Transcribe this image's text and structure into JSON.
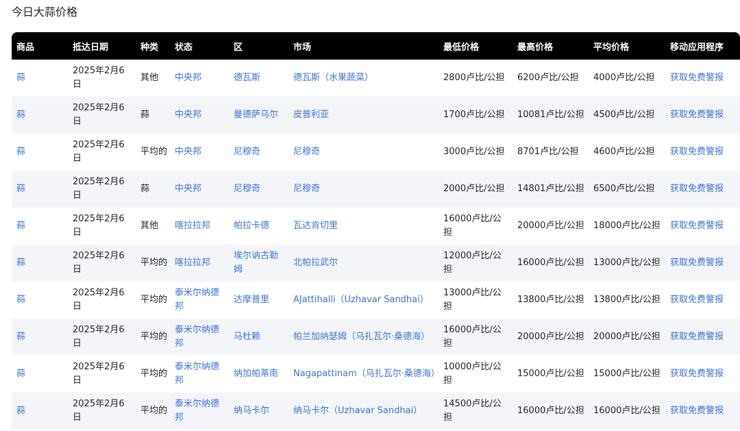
{
  "page": {
    "title": "今日大蒜价格"
  },
  "table": {
    "headers": [
      "商品",
      "抵达日期",
      "种类",
      "状态",
      "区",
      "市场",
      "最低价格",
      "最高价格",
      "平均价格",
      "移动应用程序"
    ],
    "rows": [
      [
        "蒜",
        "2025年2月6日",
        "其他",
        "中央邦",
        "德瓦斯",
        "德瓦斯（水果蔬菜）",
        "2800卢比/公担",
        "6200卢比/公担",
        "4000卢比/公担",
        "获取免费警报"
      ],
      [
        "蒜",
        "2025年2月6日",
        "蒜",
        "中央邦",
        "曼德萨乌尔",
        "皮普利亚",
        "1700卢比/公担",
        "10081卢比/公担",
        "4500卢比/公担",
        "获取免费警报"
      ],
      [
        "蒜",
        "2025年2月6日",
        "平均的",
        "中央邦",
        "尼穆奇",
        "尼穆奇",
        "3000卢比/公担",
        "8701卢比/公担",
        "4600卢比/公担",
        "获取免费警报"
      ],
      [
        "蒜",
        "2025年2月6日",
        "蒜",
        "中央邦",
        "尼穆奇",
        "尼穆奇",
        "2000卢比/公担",
        "14801卢比/公担",
        "6500卢比/公担",
        "获取免费警报"
      ],
      [
        "蒜",
        "2025年2月6日",
        "其他",
        "喀拉拉邦",
        "帕拉卡德",
        "瓦达肯切里",
        "16000卢比/公担",
        "20000卢比/公担",
        "18000卢比/公担",
        "获取免费警报"
      ],
      [
        "蒜",
        "2025年2月6日",
        "平均的",
        "喀拉拉邦",
        "埃尔讷古勒姆",
        "北帕拉武尔",
        "12000卢比/公担",
        "16000卢比/公担",
        "13000卢比/公担",
        "获取免费警报"
      ],
      [
        "蒜",
        "2025年2月6日",
        "平均的",
        "泰米尔纳德邦",
        "达摩普里",
        "AJattihalli（Uzhavar Sandhai）",
        "13000卢比/公担",
        "13800卢比/公担",
        "13800卢比/公担",
        "获取免费警报"
      ],
      [
        "蒜",
        "2025年2月6日",
        "平均的",
        "泰米尔纳德邦",
        "马杜赖",
        "帕兰加纳瑟姆（乌扎瓦尔·桑德海）",
        "16000卢比/公担",
        "20000卢比/公担",
        "20000卢比/公担",
        "获取免费警报"
      ],
      [
        "蒜",
        "2025年2月6日",
        "平均的",
        "泰米尔纳德邦",
        "纳加帕蒂南",
        "Nagapattinam（乌扎瓦尔·桑德海）",
        "10000卢比/公担",
        "15000卢比/公担",
        "15000卢比/公担",
        "获取免费警报"
      ],
      [
        "蒜",
        "2025年2月6日",
        "平均的",
        "泰米尔纳德邦",
        "纳马卡尔",
        "纳马卡尔（Uzhavar Sandhai）",
        "14500卢比/公担",
        "16000卢比/公担",
        "16000卢比/公担",
        "获取免费警报"
      ]
    ]
  },
  "colors": {
    "header_bg": "#000000",
    "link": "#3b73d6",
    "stripe": "#f4f5f9"
  }
}
